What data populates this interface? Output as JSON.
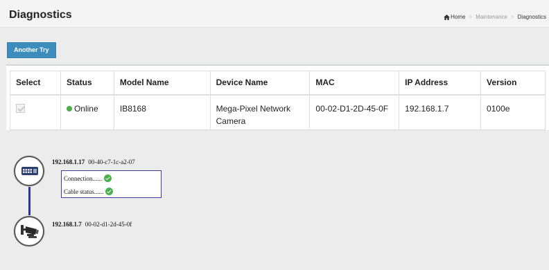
{
  "header": {
    "title": "Diagnostics",
    "breadcrumb": {
      "home": "Home",
      "separator": ">",
      "items": [
        "Maintenance",
        "Diagnostics"
      ]
    }
  },
  "actions": {
    "retry_label": "Another Try"
  },
  "table": {
    "columns": [
      "Select",
      "Status",
      "Model Name",
      "Device Name",
      "MAC",
      "IP Address",
      "Version"
    ],
    "rows": [
      {
        "selected": true,
        "status": "Online",
        "status_color": "#4cae4c",
        "model": "IB8168",
        "device_name": "Mega-Pixel Network Camera",
        "mac": "00-02-D1-2D-45-0F",
        "ip": "192.168.1.7",
        "version": "0100e"
      }
    ]
  },
  "topology": {
    "switch": {
      "icon": "network-switch-icon",
      "ip": "192.168.1.17",
      "mac": "00-40-c7-1c-a2-07",
      "connection_label": "Connection......",
      "cable_label": "Cable status......",
      "connection_ok": true,
      "cable_ok": true
    },
    "camera": {
      "icon": "camera-icon",
      "ip": "192.168.1.7",
      "mac": "00-02-d1-2d-45-0f"
    },
    "link_color": "#2b35a8"
  },
  "colors": {
    "accent": "#3c8dbc",
    "ok": "#4cae4c"
  }
}
